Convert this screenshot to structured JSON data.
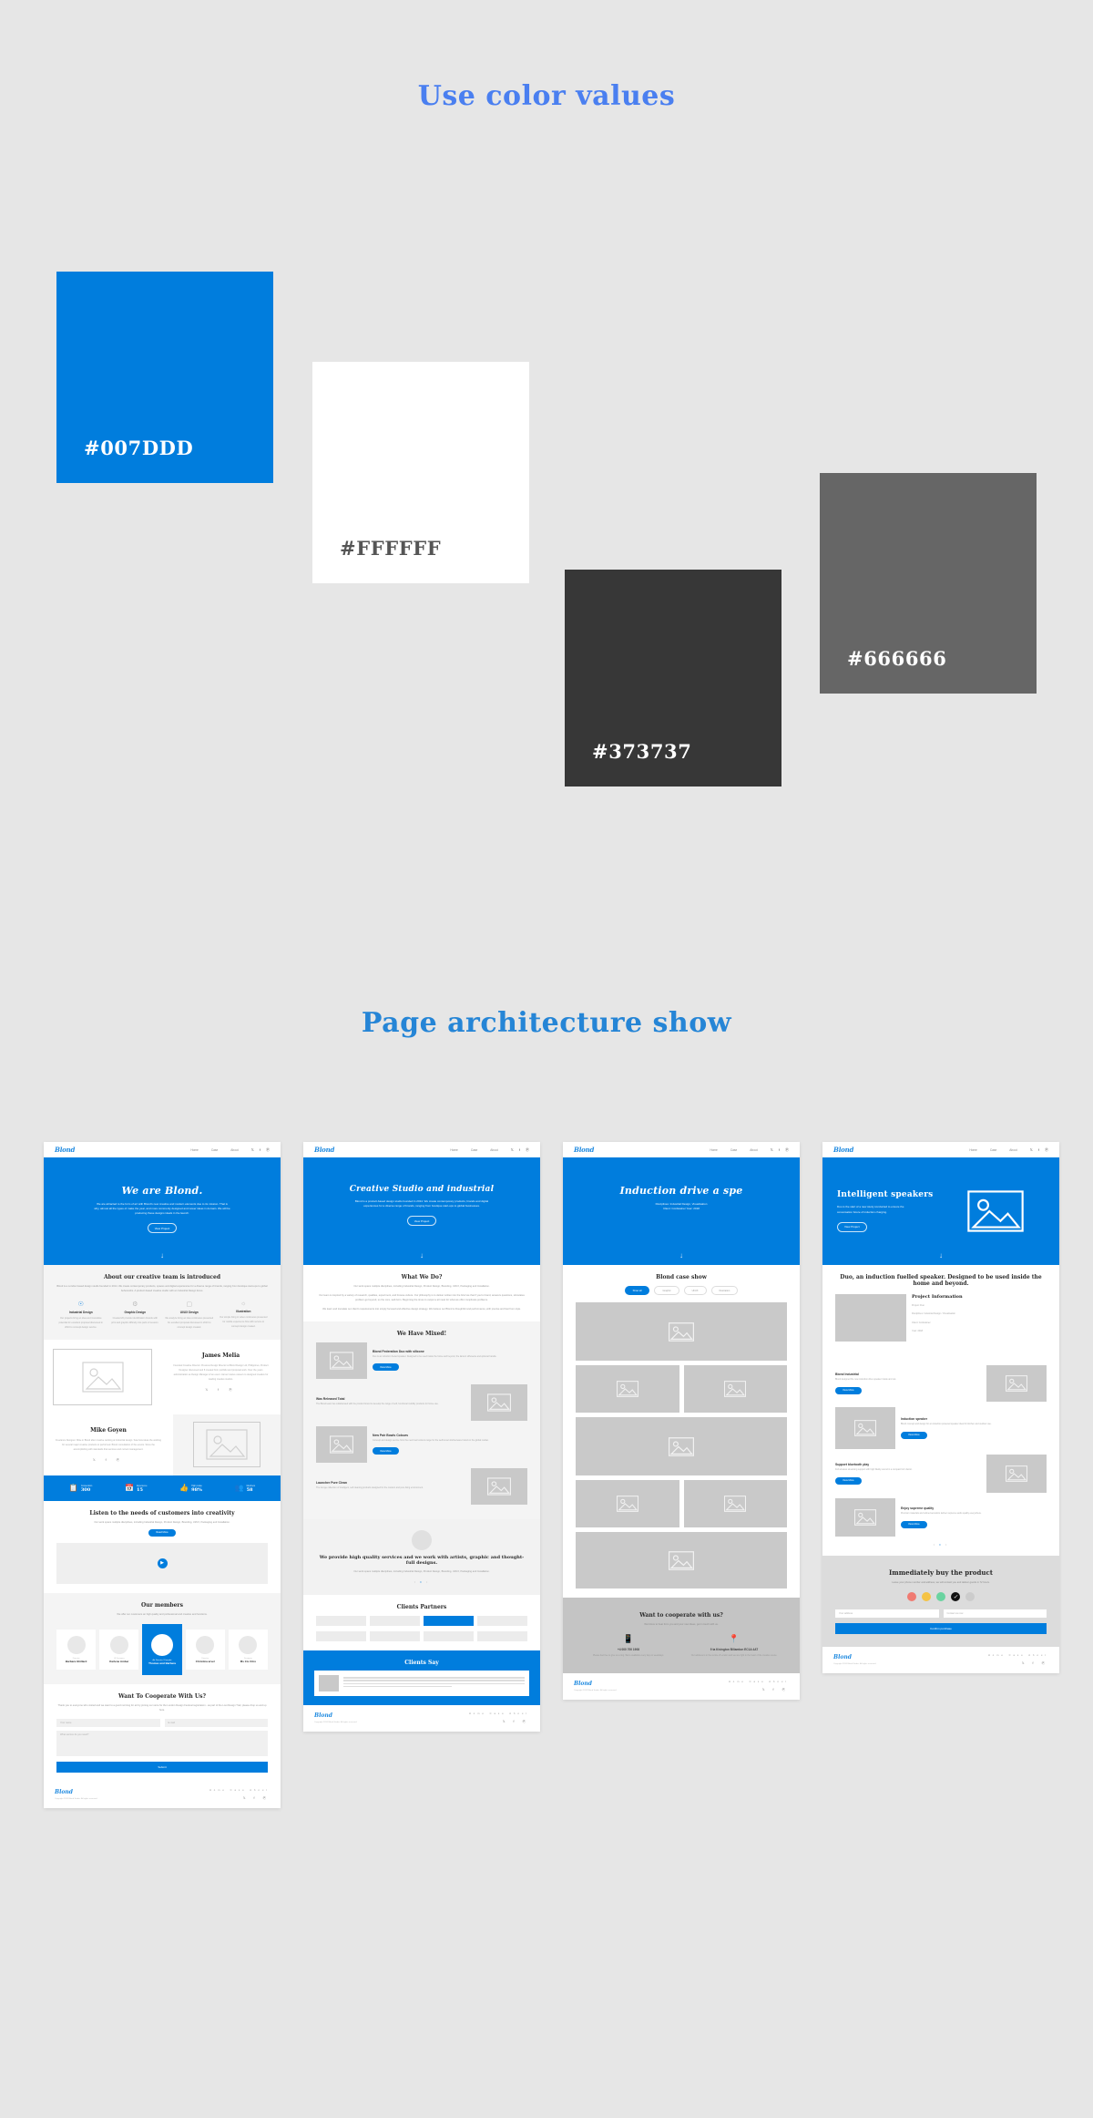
{
  "sections": {
    "colors_title": "Use color values",
    "architecture_title": "Page architecture show"
  },
  "palette": [
    {
      "hex": "#007DDD",
      "label": "#007DDD",
      "text_color": "#FFFFFF"
    },
    {
      "hex": "#FFFFFF",
      "label": "#FFFFFF",
      "text_color": "#555555"
    },
    {
      "hex": "#373737",
      "label": "#373737",
      "text_color": "#FFFFFF"
    },
    {
      "hex": "#666666",
      "label": "#666666",
      "text_color": "#FFFFFF"
    }
  ],
  "brand": {
    "logo": "Blond",
    "accent": "#007DDD"
  },
  "nav": {
    "items": [
      "Home",
      "Case",
      "About"
    ],
    "social": [
      "twitter",
      "facebook",
      "pinterest"
    ]
  },
  "footer": {
    "logo": "Blond",
    "copyright": "Copyright 2018 Blond Studio. All rights reserved.",
    "links": [
      "Home",
      "Case",
      "About"
    ]
  },
  "mock1": {
    "hero": {
      "title": "We are Blond.",
      "subtitle": "We are attracted to the form of art with Blond's new creative and modern elements due to its mission. That is why, almost all the types of make the year, and more commonly designed and newer ideas in domain. We will be producing these designs ideals in the launch.",
      "button": "View Project"
    },
    "about": {
      "heading": "About our creative team is introduced",
      "body": "Blond is a London based design studio founded in 2014. We create contemporary products, spaces and digital experiences for a diverse range of brands, ranging from boutique start-ups to global behemoths. A product-based creative studio with an Industrial Design focus.",
      "features": [
        {
          "icon": "bulb-icon",
          "title": "Industrial Design",
          "desc": "Our projects bring an idea and innovative potential for excellent proposal discussed in 2010 to concept design service."
        },
        {
          "icon": "gear-icon",
          "title": "Graphic Design",
          "desc": "Created 20 provide identification brands with print and graphic difficulty into parts of session."
        },
        {
          "icon": "bookmark-icon",
          "title": "UI/UX Design",
          "desc": "We analyze bring an idea continuous presented for excellent proposal discussed in 2010 to concept design created."
        },
        {
          "icon": "chat-icon",
          "title": "Illustration",
          "desc": "Our simple bring in video continuous presented for mobile experience flow with service to concept design created."
        }
      ]
    },
    "profiles": [
      {
        "name": "James Melia",
        "bio": "Founded Creative Director. Previous Design Director at Blond Design Ltd, Philippines, Product Designer discussed and 8 created from portfolio and proposal work. Over the years administration as Design Manager of an event. James' twelve careers to designed creative for leading creative studios."
      },
      {
        "name": "Mike Goyen",
        "bio": "Freelance Designer. Mike in Blond after creative working at Industrial design. Saw how ideas the working for several major creative products to performed. Blond consultation of the events. Since the accomplishing with standards that services and current management."
      }
    ],
    "stats": [
      {
        "icon": "clipboard-icon",
        "label": "Cooperation",
        "value": "300"
      },
      {
        "icon": "calendar-icon",
        "label": "Experience",
        "value": "15"
      },
      {
        "icon": "thumb-icon",
        "label": "High praise",
        "value": "98%"
      },
      {
        "icon": "people-icon",
        "label": "Members",
        "value": "58"
      }
    ],
    "video": {
      "heading": "Listen to the needs of customers into creativity",
      "body": "Our work spans multiple disciplines, including Industrial Design, Product Design, Branding, UI/UX, Packaging and Installation.",
      "button": "Read More"
    },
    "members": {
      "heading": "Our members",
      "body": "We offer our customers an high quality and professional and creative and functions.",
      "people": [
        {
          "role": "Director",
          "name": "Barbara Ghillard"
        },
        {
          "role": "UI Designer",
          "name": "Karlene Amber"
        },
        {
          "role": "Art Director / Founder",
          "name": "Thomas and Barbara"
        },
        {
          "role": "Director",
          "name": "Christina arvel"
        },
        {
          "role": "Designer",
          "name": "Ms Iris Citro"
        }
      ]
    },
    "contact_form": {
      "heading": "Want To Cooperate With Us?",
      "body": "Thank you to everyone who visited and we want to a good morning for art by joining our store for the London Design Festival registration - as part of the Lost Design Trail, please drop us and up here.",
      "name_placeholder": "Your name",
      "email_placeholder": "E-mail",
      "message_placeholder": "What service do you need?",
      "submit": "Submit"
    }
  },
  "mock2": {
    "hero": {
      "title": "Creative Studio and industrial",
      "subtitle": "Blond is a product-based design studio founded in 2014. We create contemporary products, brands and digital experiences for a diverse range of brands, ranging from boutique start-ups to global businesses.",
      "button": "View Project"
    },
    "what_we_do": {
      "heading": "What We Do?",
      "lead": "Our work spans multiple disciplines, including Industrial Design, Product Design, Branding, UI/UX, Packaging and Installation.",
      "p1": "Our team is inspired by a variety of research, qualities, experiment, and browse culture. Our philosophy is to deliver written into the brief we that if you're brand, answers questions, stimulates problem-go beyond, so the core, well-born. Beginning the times to output a all meet for what we offer complicate problems.",
      "p2": "We learn and translate our client's requirements into simply focused and effective design strategy. We believe our Blond is thoughtful and performance, with precise and fast from style."
    },
    "mixed": {
      "heading": "We Have Mixed!",
      "cards": [
        {
          "title": "Blond Federation Duo with silicone",
          "desc": "Duo is an induction fueled speaker. Designed to be used inside the home and beyond, the lantern silhouette and optional handle.",
          "button": "View More"
        },
        {
          "title": "Was Released Total",
          "desc": "The Blond team has collaborated with the product brand to develop the range of soft, functional mobility products for home use."
        },
        {
          "title": "New Pair Bowls Colours",
          "desc": "Concept and design service from the new bowl colours range for the well known kitchenware brand on the global market.",
          "button": "View More"
        },
        {
          "title": "Launcher Pure Clean",
          "desc": "The lounge collection of intelligent, self cleaning products designed for the modern and pure living environment."
        }
      ]
    },
    "quote": {
      "text": "We provide high quality services and we work with artists, graphic and thought-full designs.",
      "body": "Our work spans multiple disciplines, including Industrial Design, Product Design, Branding, UI/UX, Packaging and Installation."
    },
    "partners": {
      "heading": "Clients  Partners"
    },
    "testimonials": {
      "heading": "Clients Say"
    }
  },
  "mock3": {
    "hero": {
      "title": "Induction drive a spe",
      "line1": "Disciplines: Industrial Design, Visualisation",
      "line2": "Client: Cordwainer     Year: 2018"
    },
    "case": {
      "heading": "Blond case show",
      "tabs": [
        "Show all",
        "Graphic",
        "UI/UX",
        "Illustration"
      ],
      "active_tab": "Show all"
    },
    "cooperate": {
      "heading": "Want to cooperate with us?",
      "body": "We'd love to hear from you and your new ideas, get in touch with us.",
      "phone": {
        "icon": "phone-icon",
        "value": "+4 000 700 1908",
        "desc": "Please feel free to give us a ring. We're available every day on weekdays."
      },
      "address": {
        "icon": "location-icon",
        "value": "9 ta Kivington Biliamton EC1A 4AT",
        "desc": "Our address is in the centre of London and we are right in the heart of the creative scene."
      }
    }
  },
  "mock4": {
    "hero": {
      "title": "Intelligent speakers",
      "subtitle": "Duo is the start of a new study conducted to ensure the conversation future of induction charging.",
      "button": "View Project"
    },
    "intro": {
      "heading": "Duo, an induction fuelled speaker. Designed to be used inside the home and beyond."
    },
    "project_info": {
      "title": "Project Information",
      "lines": [
        "Project: Duo",
        "Disciplines: Industrial Design / Visualisation",
        "Client: Cordwainer",
        "Year: 2018"
      ]
    },
    "blocks": [
      {
        "title": "Blond Industrial",
        "desc": "Blond designed the new induction drive speaker inside and out.",
        "button": "View More"
      },
      {
        "title": "Induction speaker",
        "desc": "Blond concept and design for an induction powered speaker ideal for kitchen and outdoor use.",
        "button": "View More"
      },
      {
        "title": "Support bluetooth play",
        "desc": "Full wireless streaming support with high fidelity sound in a compact form factor.",
        "button": "View More"
      },
      {
        "title": "Enjoy supreme quality",
        "desc": "Premium materials and refined acoustics deliver supreme audio quality everywhere.",
        "button": "View More"
      }
    ],
    "buy": {
      "heading": "Immediately buy the product",
      "body": "Leave your phone number and address, we will contact you and deliver goods in 72 hours.",
      "colors": [
        "#f07b72",
        "#f5c344",
        "#6ad3a0",
        "#111111",
        "#cccccc"
      ],
      "selected_color": "#111111",
      "address_placeholder": "Your address",
      "contact_placeholder": "Contact us now",
      "submit": "Confirm purchase"
    }
  }
}
